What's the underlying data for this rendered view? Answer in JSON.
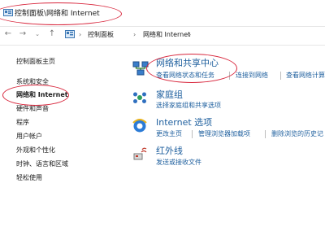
{
  "title_bar": {
    "path": "控制面板\\网络和 Internet",
    "icon": "control-panel-icon"
  },
  "address_bar": {
    "nav_icons": [
      "back-arrow-icon",
      "forward-arrow-icon",
      "dropdown-chevron-icon",
      "up-arrow-icon"
    ],
    "location_icon": "control-panel-icon",
    "breadcrumbs": [
      "控制面板",
      "网络和 Internet"
    ],
    "separator": "›"
  },
  "sidebar": {
    "items": [
      {
        "label": "控制面板主页"
      },
      {
        "label": "系统和安全"
      },
      {
        "label": "网络和 Internet",
        "selected": true
      },
      {
        "label": "硬件和声音"
      },
      {
        "label": "程序"
      },
      {
        "label": "用户帐户"
      },
      {
        "label": "外观和个性化"
      },
      {
        "label": "时钟、语言和区域"
      },
      {
        "label": "轻松使用"
      }
    ]
  },
  "categories": [
    {
      "icon": "network-center-icon",
      "title": "网络和共享中心",
      "links": [
        "查看网络状态和任务",
        "连接到网络",
        "查看网络计算"
      ]
    },
    {
      "icon": "homegroup-icon",
      "title": "家庭组",
      "links": [
        "选择家庭组和共享选项"
      ]
    },
    {
      "icon": "internet-explorer-icon",
      "title": "Internet 选项",
      "links": [
        "更改主页",
        "管理浏览器加载项",
        "删除浏览的历史记"
      ]
    },
    {
      "icon": "infrared-icon",
      "title": "红外线",
      "links": [
        "发送或接收文件"
      ]
    }
  ],
  "colors": {
    "link": "#1e5f9e",
    "annotation": "#d8263c",
    "text": "#1a1a1a"
  }
}
